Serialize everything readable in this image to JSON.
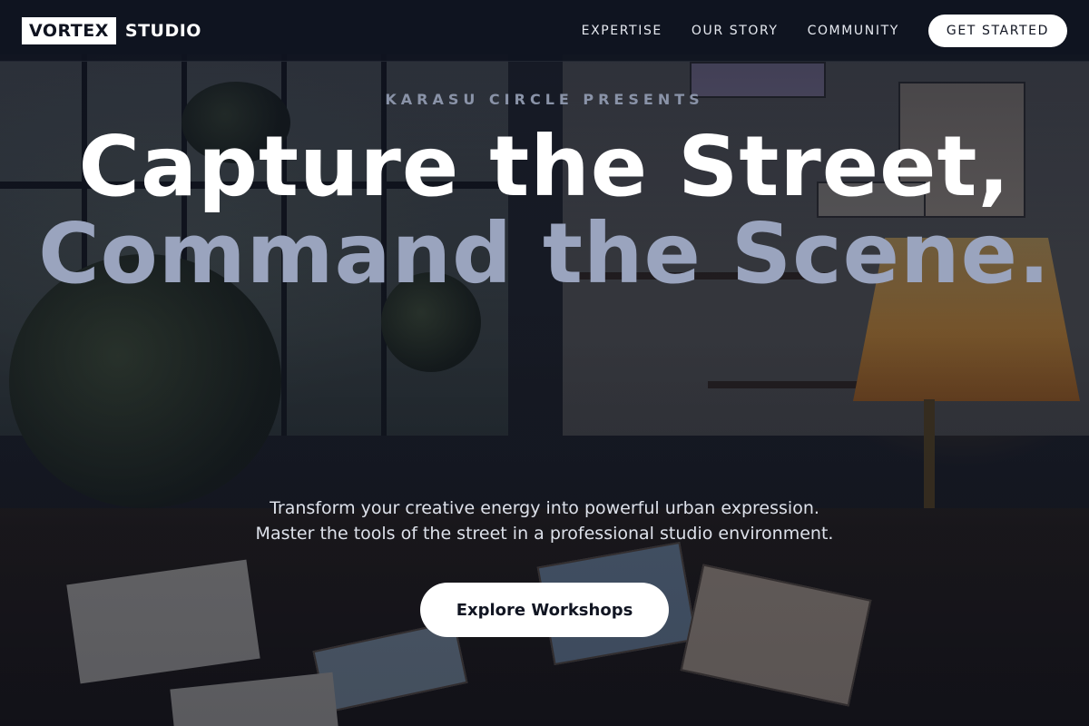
{
  "nav": {
    "logo_box": "VORTEX",
    "logo_text": "STUDIO",
    "links": [
      "EXPERTISE",
      "OUR STORY",
      "COMMUNITY"
    ],
    "cta_label": "GET STARTED"
  },
  "hero": {
    "eyebrow": "KARASU CIRCLE PRESENTS",
    "headline_line1": "Capture the Street,",
    "headline_line2": "Command the Scene.",
    "sub_line1": "Transform your creative energy into powerful urban expression.",
    "sub_line2": "Master the tools of the street in a professional studio environment.",
    "button_label": "Explore Workshops"
  },
  "colors": {
    "nav_bg": "#0f1320",
    "headline_primary": "#ffffff",
    "headline_accent": "#9aa4be",
    "eyebrow": "#8a93a8",
    "button_bg": "#ffffff",
    "button_text": "#111522"
  }
}
